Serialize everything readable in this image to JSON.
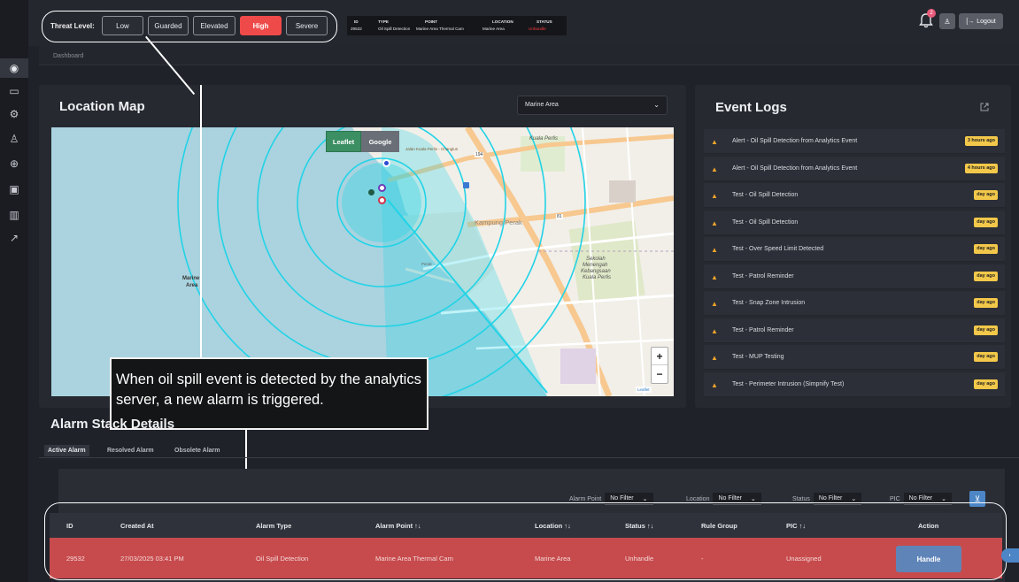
{
  "topbar": {
    "threat_label": "Threat Level:",
    "threat_levels": [
      "Low",
      "Guarded",
      "Elevated",
      "High",
      "Severe"
    ],
    "active_level": "High",
    "ticker": {
      "headers": [
        "ID",
        "TYPE",
        "POINT",
        "LOCATION",
        "STATUS"
      ],
      "values": [
        "29532",
        "Oil Spill Detection",
        "Marine Area Thermal Cam",
        "Marine Area",
        "Unhandle"
      ]
    },
    "notification_count": "2",
    "logout_label": "Logout"
  },
  "breadcrumb": "Dashboard",
  "sidebar": {
    "items": [
      "eye-icon",
      "folder-icon",
      "settings-icon",
      "user-key-icon",
      "globe-icon",
      "camera-icon",
      "chart-icon",
      "export-icon"
    ]
  },
  "map_panel": {
    "title": "Location Map",
    "area_select": "Marine Area",
    "layer_buttons": [
      "Leaflet",
      "Google"
    ],
    "labels": {
      "kuala_perlis": "Kuala Perlis",
      "kampung_perak": "Kampung Perak",
      "marine_area_1": "Marine",
      "marine_area_2": "Area",
      "school_1": "Sekolah",
      "school_2": "Menengah",
      "school_3": "Kebangsaan",
      "school_4": "Kuala Perlis",
      "road_main": "Jalan Kuala Perlis - Changlun",
      "road_194": "194",
      "road_81": "81",
      "perak": "Perak"
    },
    "zoom_in": "+",
    "zoom_out": "−",
    "attribution": "Leaflet"
  },
  "event_logs": {
    "title": "Event Logs",
    "items": [
      {
        "text": "Alert - Oil Spill Detection from Analytics Event",
        "time": "3 hours ago"
      },
      {
        "text": "Alert - Oil Spill Detection from Analytics Event",
        "time": "4 hours ago"
      },
      {
        "text": "Test - Oil Spill Detection",
        "time": "day ago"
      },
      {
        "text": "Test - Oil Spill Detection",
        "time": "day ago"
      },
      {
        "text": "Test - Over Speed Limit Detected",
        "time": "day ago"
      },
      {
        "text": "Test - Patrol Reminder",
        "time": "day ago"
      },
      {
        "text": "Test - Snap Zone Intrusion",
        "time": "day ago"
      },
      {
        "text": "Test - Patrol Reminder",
        "time": "day ago"
      },
      {
        "text": "Test - MUP Testing",
        "time": "day ago"
      },
      {
        "text": "Test - Perimeter Intrusion (Simpnify Test)",
        "time": "day ago"
      }
    ]
  },
  "callout": {
    "text": "When oil spill event is detected by the analytics server, a new alarm is triggered."
  },
  "alarm_stack": {
    "title": "Alarm Stack Details",
    "tabs": [
      "Active Alarm",
      "Resolved Alarm",
      "Obsolete Alarm"
    ],
    "filters": [
      {
        "label": "Alarm Point",
        "value": "No Filter"
      },
      {
        "label": "Location",
        "value": "No Filter"
      },
      {
        "label": "Status",
        "value": "No Filter"
      },
      {
        "label": "PIC",
        "value": "No Filter"
      }
    ],
    "columns": [
      "ID",
      "Created At",
      "Alarm Type",
      "Alarm Point ↑↓",
      "Location ↑↓",
      "Status ↑↓",
      "Rule Group",
      "PIC ↑↓",
      "Action"
    ],
    "rows": [
      {
        "id": "29532",
        "created_at": "27/03/2025 03:41 PM",
        "alarm_type": "Oil Spill Detection",
        "alarm_point": "Marine Area Thermal Cam",
        "location": "Marine Area",
        "status": "Unhandle",
        "rule_group": "-",
        "pic": "Unassigned",
        "action": "Handle"
      }
    ]
  },
  "colors": {
    "accent_red": "#ef4a4a",
    "alarm_row": "#c74b4d",
    "badge_yellow": "#f3c84a",
    "handle_blue": "#5f84b8"
  }
}
